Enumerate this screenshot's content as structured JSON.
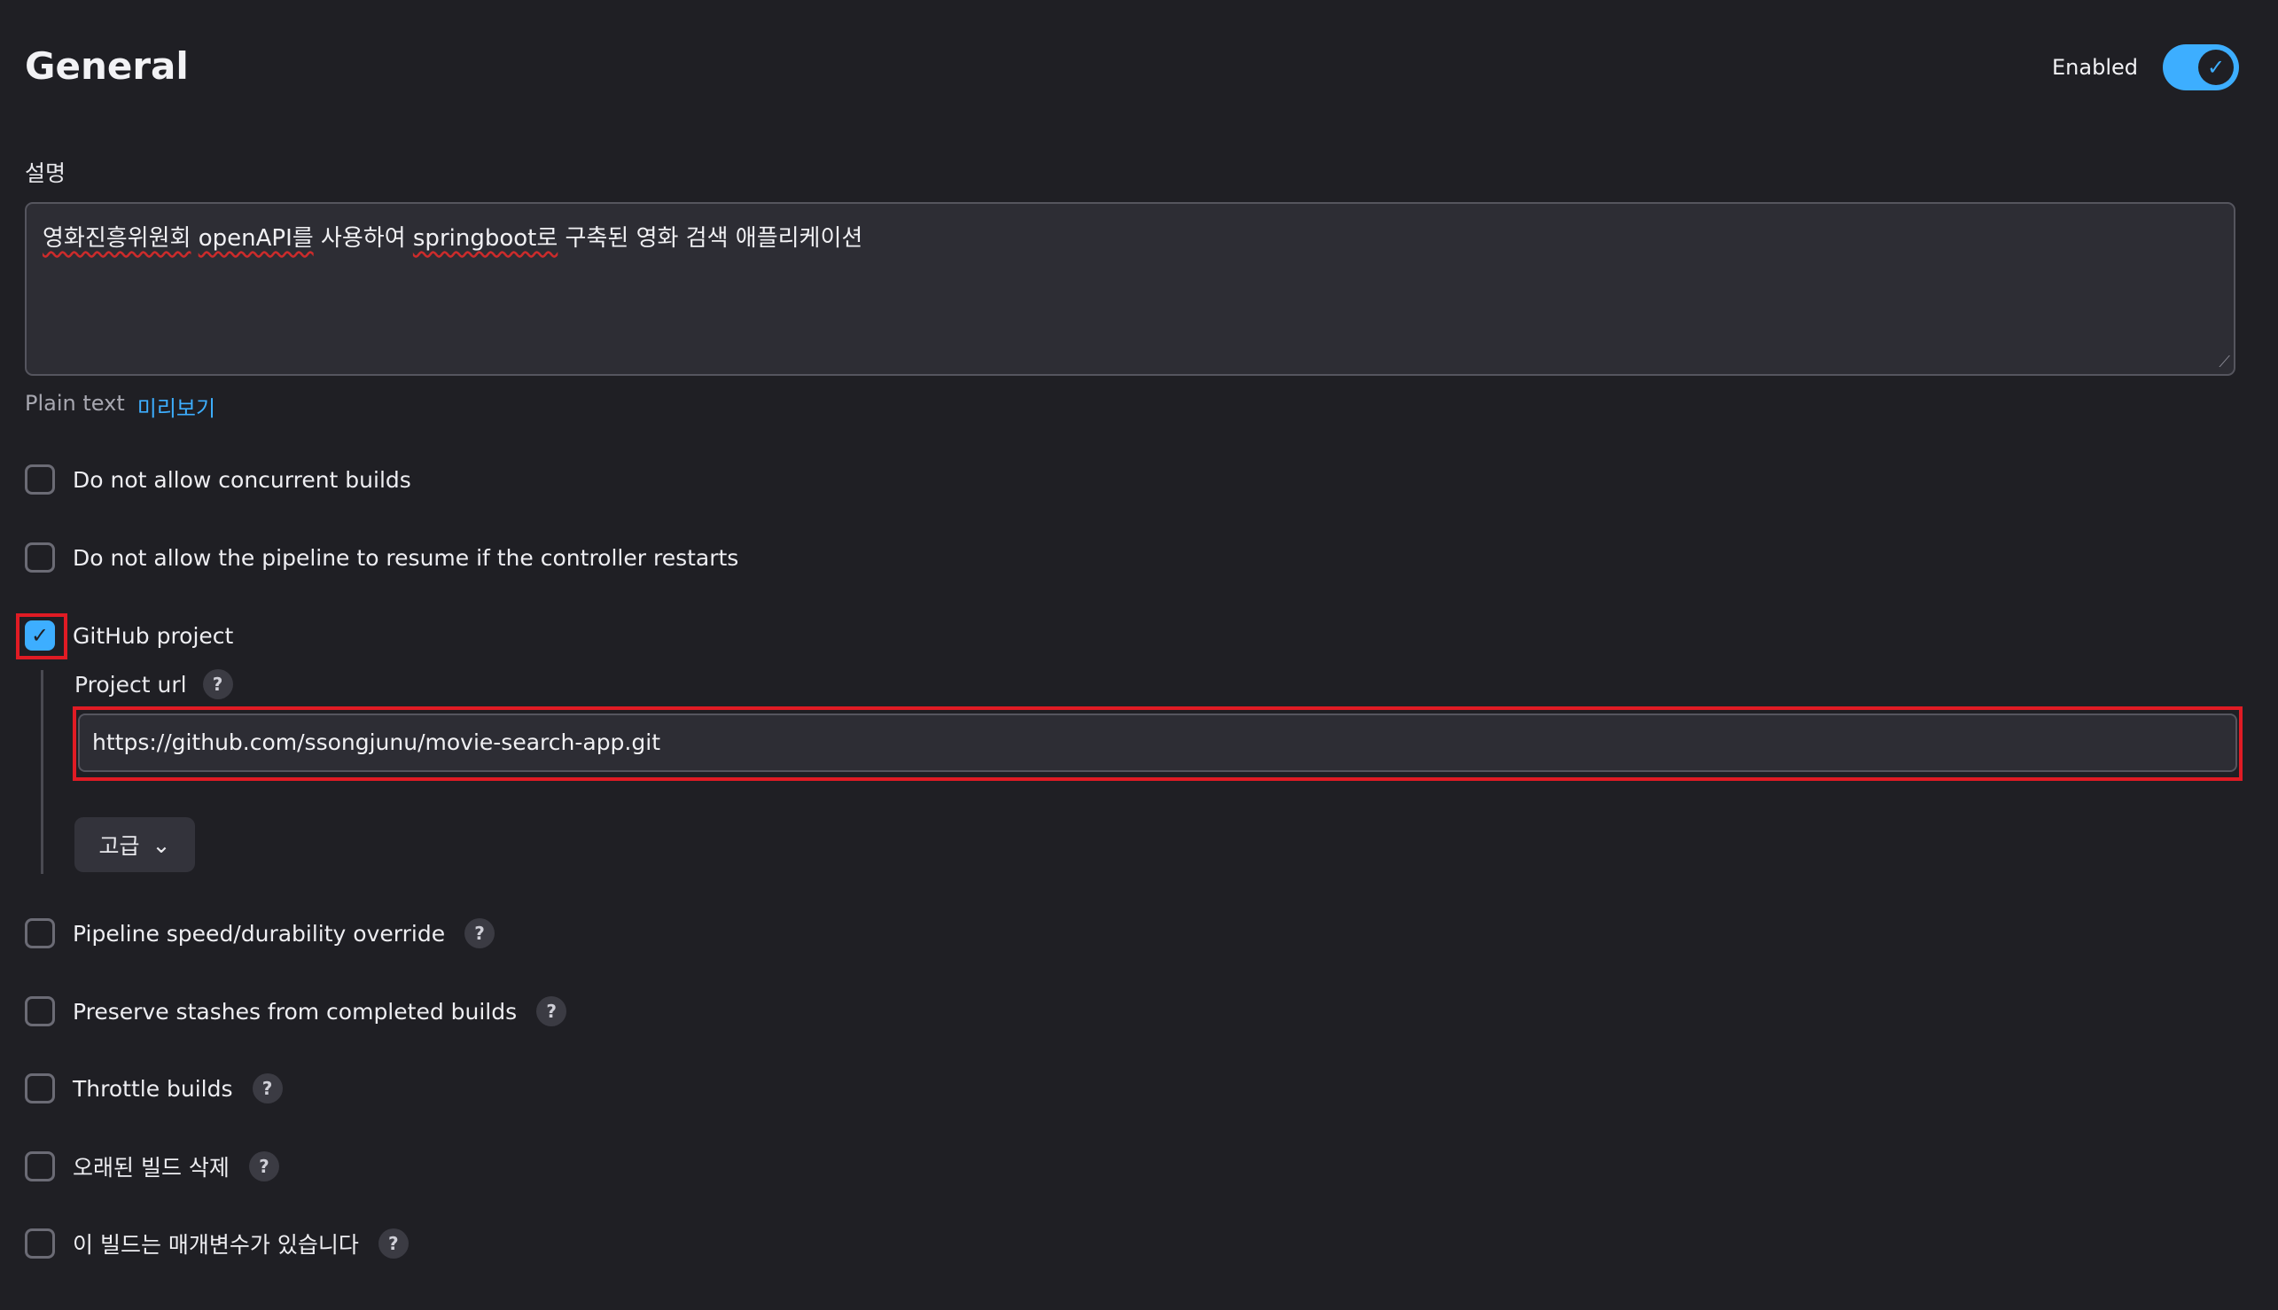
{
  "header": {
    "title": "General",
    "enabled_label": "Enabled",
    "toggle_check": "✓"
  },
  "description": {
    "label": "설명",
    "value_parts": {
      "p1": "영화진흥위원회",
      "p2": " ",
      "p3": "openAPI를",
      "p4": " 사용하여 ",
      "p5": "springboot로",
      "p6": " 구축된 영화 검색 애플리케이션"
    },
    "format": "Plain text",
    "preview": "미리보기"
  },
  "options": {
    "concurrent": "Do not allow concurrent builds",
    "resume": "Do not allow the pipeline to resume if the controller restarts",
    "github": "GitHub project",
    "durability": "Pipeline speed/durability override",
    "stashes": "Preserve stashes from completed builds",
    "throttle": "Throttle builds",
    "old_builds": "오래된 빌드 삭제",
    "params": "이 빌드는 매개변수가 있습니다"
  },
  "github_project": {
    "checked": true,
    "project_url_label": "Project url",
    "project_url_value": "https://github.com/ssongjunu/movie-search-app.git",
    "advanced_label": "고급",
    "advanced_chevron": "⌄"
  },
  "help_glyph": "?",
  "check_glyph": "✓",
  "colors": {
    "background": "#1f1f24",
    "accent": "#3daeff",
    "highlight": "#e01b24",
    "input_bg": "#2d2d34"
  }
}
